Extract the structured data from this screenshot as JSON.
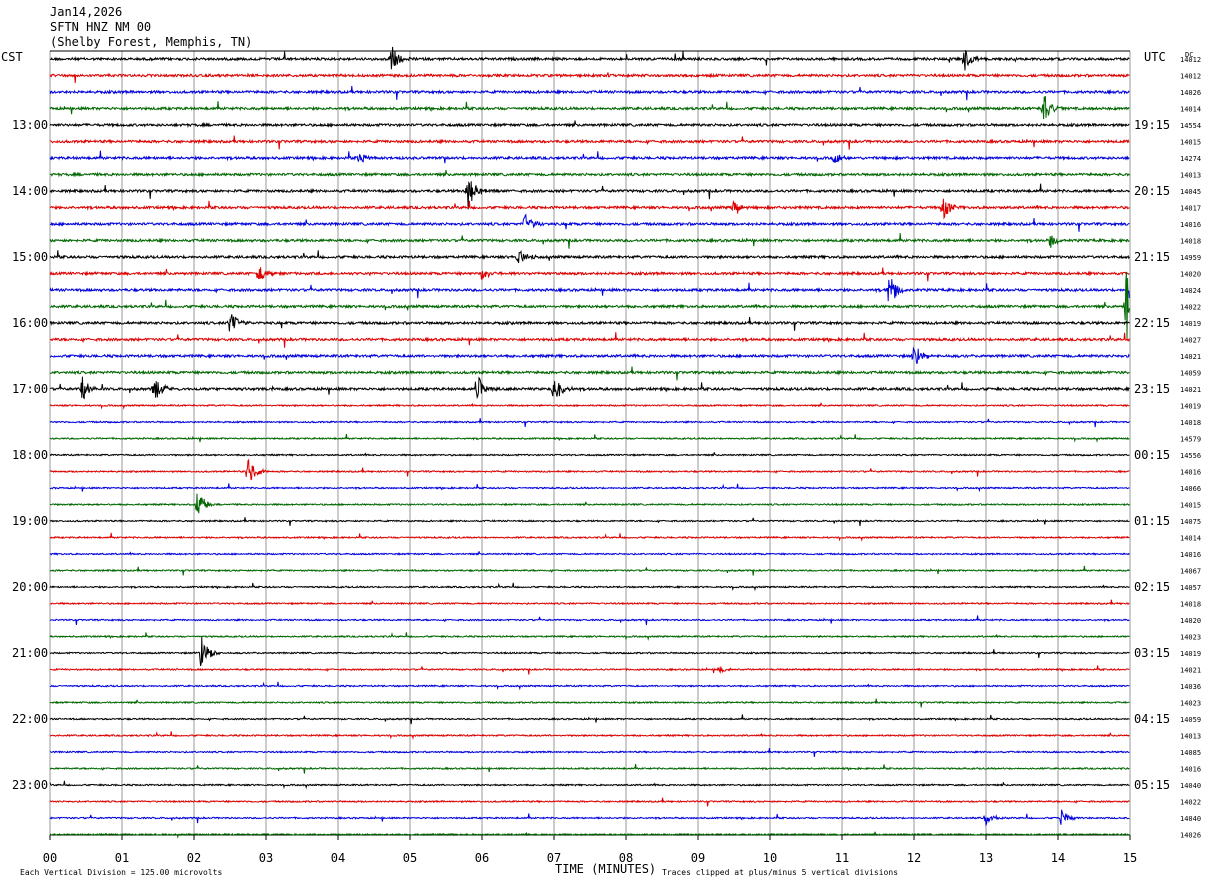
{
  "header": {
    "date": "Jan14,2026",
    "station": "SFTN HNZ NM 00",
    "location": "(Shelby Forest, Memphis, TN)"
  },
  "left_tz": "CST",
  "right_tz": "UTC",
  "right_corner": "DC",
  "footer": {
    "scale_note": "Each Vertical Division =  125.00 microvolts",
    "xlabel": "TIME (MINUTES)",
    "clip_note": "Traces clipped at plus/minus 5 vertical divisions"
  },
  "colors": {
    "trace_cycle": [
      "#000000",
      "#dd0000",
      "#0000dd",
      "#006600"
    ],
    "grid": "#9a9a9a"
  },
  "chart_data": {
    "type": "line",
    "title": "SFTN HNZ NM 00",
    "xlabel": "TIME (MINUTES)",
    "xlim": [
      0,
      15
    ],
    "x_ticks": [
      "00",
      "01",
      "02",
      "03",
      "04",
      "05",
      "06",
      "07",
      "08",
      "09",
      "10",
      "11",
      "12",
      "13",
      "14",
      "15"
    ],
    "rows": 48,
    "minutes_per_row": 15,
    "left_hour_labels": [
      "13:00",
      "14:00",
      "15:00",
      "16:00",
      "17:00",
      "18:00",
      "19:00",
      "20:00",
      "21:00",
      "22:00",
      "23:00"
    ],
    "right_hour_labels": [
      "19:15",
      "20:15",
      "21:15",
      "22:15",
      "23:15",
      "00:15",
      "01:15",
      "02:15",
      "03:15",
      "04:15",
      "05:15"
    ],
    "row_values": [
      "14012",
      "14012",
      "14026",
      "14014",
      "14554",
      "14015",
      "14274",
      "14013",
      "14045",
      "14017",
      "14016",
      "14018",
      "14959",
      "14020",
      "14024",
      "14022",
      "14019",
      "14027",
      "14021",
      "14059",
      "14021",
      "14019",
      "14018",
      "14579",
      "14556",
      "14016",
      "14066",
      "14015",
      "14075",
      "14014",
      "14016",
      "14067",
      "14057",
      "14018",
      "14020",
      "14023",
      "14019",
      "14021",
      "14036",
      "14023",
      "14059",
      "14013",
      "14085",
      "14016",
      "14040",
      "14022",
      "14040",
      "14026"
    ],
    "events": [
      {
        "row": 0,
        "minute": 4.75,
        "amp": 14
      },
      {
        "row": 0,
        "minute": 12.7,
        "amp": 13
      },
      {
        "row": 3,
        "minute": 13.8,
        "amp": 16
      },
      {
        "row": 6,
        "minute": 4.3,
        "amp": 7
      },
      {
        "row": 6,
        "minute": 10.9,
        "amp": 6
      },
      {
        "row": 8,
        "minute": 5.8,
        "amp": 20
      },
      {
        "row": 9,
        "minute": 9.5,
        "amp": 9
      },
      {
        "row": 9,
        "minute": 12.4,
        "amp": 14
      },
      {
        "row": 10,
        "minute": 6.6,
        "amp": 10
      },
      {
        "row": 11,
        "minute": 13.9,
        "amp": 7
      },
      {
        "row": 12,
        "minute": 6.5,
        "amp": 9
      },
      {
        "row": 13,
        "minute": 2.9,
        "amp": 10
      },
      {
        "row": 13,
        "minute": 6.0,
        "amp": 8
      },
      {
        "row": 14,
        "minute": 11.65,
        "amp": 18
      },
      {
        "row": 14,
        "minute": 15.0,
        "amp": 30
      },
      {
        "row": 15,
        "minute": 14.95,
        "amp": 40
      },
      {
        "row": 16,
        "minute": 2.5,
        "amp": 12
      },
      {
        "row": 18,
        "minute": 12.0,
        "amp": 14
      },
      {
        "row": 20,
        "minute": 0.45,
        "amp": 14
      },
      {
        "row": 20,
        "minute": 1.45,
        "amp": 14
      },
      {
        "row": 20,
        "minute": 5.95,
        "amp": 15
      },
      {
        "row": 20,
        "minute": 7.0,
        "amp": 15
      },
      {
        "row": 25,
        "minute": 2.75,
        "amp": 16
      },
      {
        "row": 27,
        "minute": 2.05,
        "amp": 17
      },
      {
        "row": 36,
        "minute": 2.1,
        "amp": 18
      },
      {
        "row": 37,
        "minute": 9.3,
        "amp": 4
      },
      {
        "row": 46,
        "minute": 13.0,
        "amp": 7
      },
      {
        "row": 46,
        "minute": 14.05,
        "amp": 9
      }
    ]
  }
}
